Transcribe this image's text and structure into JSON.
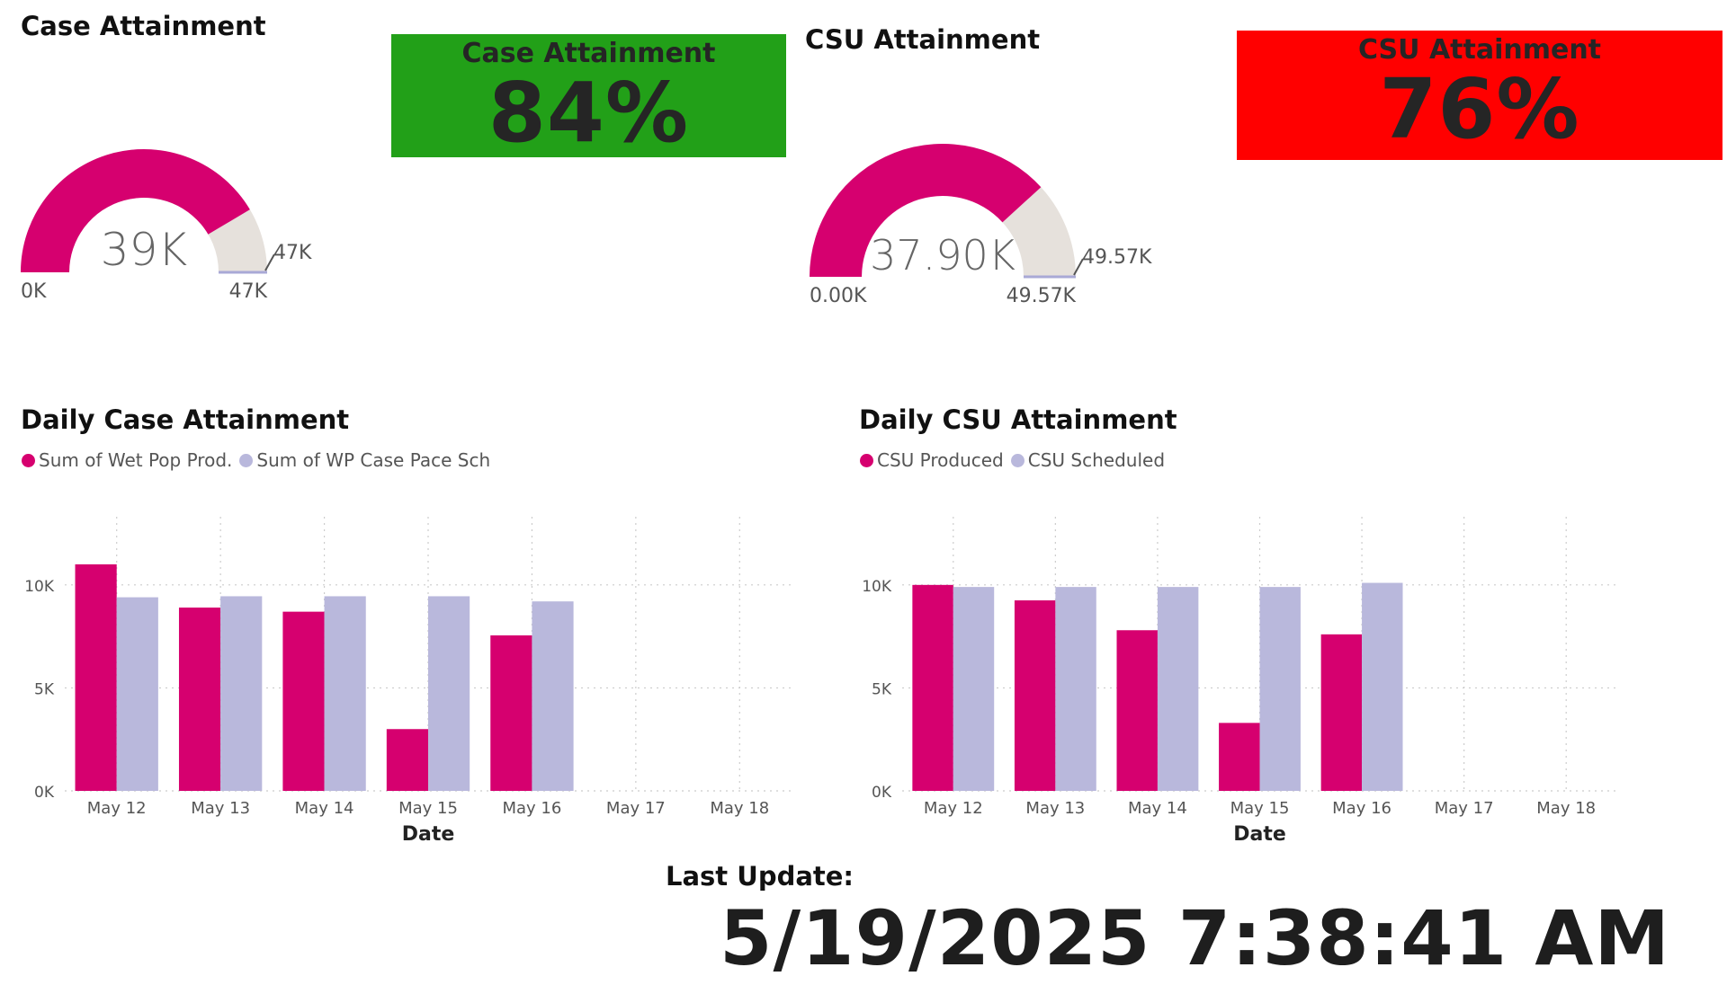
{
  "colors": {
    "produced": "#D6006F",
    "scheduled": "#B9B8DC",
    "gauge_bg": "#E6E1DC",
    "kpi_good": "#22A018",
    "kpi_bad": "#FF0000",
    "grid": "#CCCCCC"
  },
  "gauges": [
    {
      "title": "Case Attainment",
      "value": 39000,
      "min": 0,
      "max": 47000,
      "target": 47000,
      "value_label": "39K",
      "min_label": "0K",
      "max_label": "47K",
      "target_label": "47K"
    },
    {
      "title": "CSU Attainment",
      "value": 37900,
      "min": 0,
      "max": 49570,
      "target": 49570,
      "value_label": "37.90K",
      "min_label": "0.00K",
      "max_label": "49.57K",
      "target_label": "49.57K"
    }
  ],
  "kpis": [
    {
      "label": "Case Attainment",
      "value": "84%",
      "status": "good"
    },
    {
      "label": "CSU Attainment",
      "value": "76%",
      "status": "bad"
    }
  ],
  "chart_data": [
    {
      "type": "bar",
      "title": "Daily Case Attainment",
      "xlabel": "Date",
      "ylabel": "",
      "categories": [
        "May 12",
        "May 13",
        "May 14",
        "May 15",
        "May 16",
        "May 17",
        "May 18"
      ],
      "series": [
        {
          "name": "Sum of Wet Pop Prod.",
          "values": [
            11000,
            8900,
            8700,
            3000,
            7550,
            null,
            null
          ]
        },
        {
          "name": "Sum of WP Case Pace Sch",
          "values": [
            9400,
            9450,
            9450,
            9450,
            9200,
            null,
            null
          ]
        }
      ],
      "yticks": [
        0,
        5000,
        10000
      ],
      "ytick_labels": [
        "0K",
        "5K",
        "10K"
      ],
      "ylim": [
        0,
        12000
      ],
      "grid": true,
      "legend": "top-left"
    },
    {
      "type": "bar",
      "title": "Daily CSU Attainment",
      "xlabel": "Date",
      "ylabel": "",
      "categories": [
        "May 12",
        "May 13",
        "May 14",
        "May 15",
        "May 16",
        "May 17",
        "May 18"
      ],
      "series": [
        {
          "name": "CSU Produced",
          "values": [
            10000,
            9250,
            7800,
            3300,
            7600,
            null,
            null
          ]
        },
        {
          "name": "CSU Scheduled",
          "values": [
            9900,
            9900,
            9900,
            9900,
            10100,
            null,
            null
          ]
        }
      ],
      "yticks": [
        0,
        5000,
        10000
      ],
      "ytick_labels": [
        "0K",
        "5K",
        "10K"
      ],
      "ylim": [
        0,
        12000
      ],
      "grid": true,
      "legend": "top-left"
    }
  ],
  "footer": {
    "label": "Last Update:",
    "timestamp": "5/19/2025 7:38:41 AM"
  }
}
